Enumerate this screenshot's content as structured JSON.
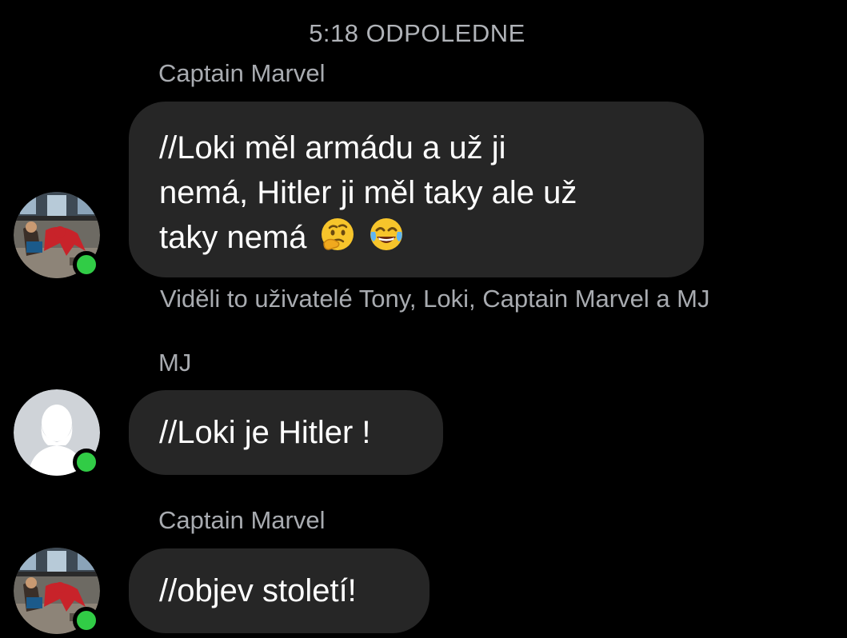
{
  "timestamp": "5:18 ODPOLEDNE",
  "messages": [
    {
      "sender": "Captain Marvel",
      "text_lines": [
        "//Loki měl armádu a už ji",
        "nemá, Hitler ji měl taky ale už",
        "taky nemá"
      ],
      "emojis": [
        "thinking-face-emoji",
        "tears-of-joy-emoji"
      ],
      "avatar": "spiderman-photo-avatar",
      "online": true
    },
    {
      "sender": "MJ",
      "text": "//Loki je Hitler !",
      "avatar": "default-silhouette-avatar",
      "online": true
    },
    {
      "sender": "Captain Marvel",
      "text": "//objev století!",
      "avatar": "spiderman-photo-avatar",
      "online": true
    }
  ],
  "seen_receipt": "Viděli to uživatelé Tony, Loki, Captain Marvel a MJ",
  "colors": {
    "background": "#000000",
    "bubble": "#262626",
    "secondary_text": "#a8abb0",
    "online": "#31cc46"
  }
}
